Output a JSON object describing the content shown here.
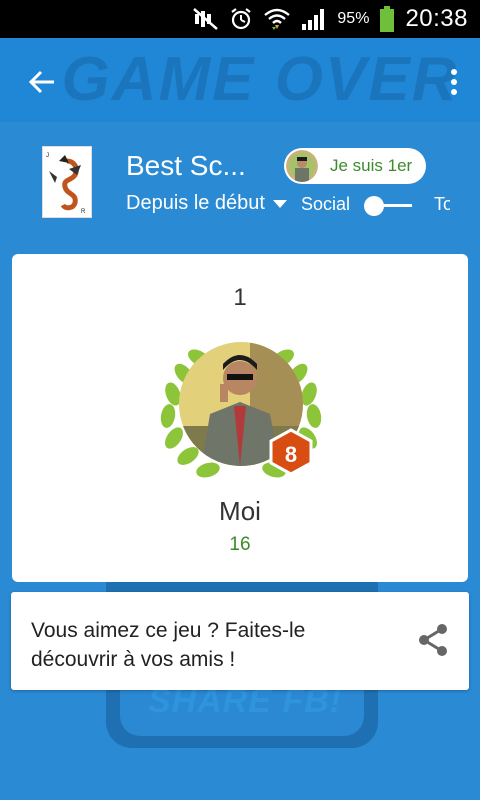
{
  "status_bar": {
    "battery_percent": "95%",
    "time": "20:38",
    "icons": [
      "mute-icon",
      "alarm-icon",
      "wifi-icon",
      "signal-icon",
      "battery-icon"
    ]
  },
  "app_bar": {
    "background_title": "GAME OVER",
    "back_icon": "arrow-back-icon",
    "menu_icon": "overflow-menu-icon"
  },
  "header": {
    "title": "Best Sc...",
    "period": "Depuis le début",
    "social_label": "Social",
    "tout_label": "To",
    "first_badge_label": "Je suis 1er"
  },
  "leaderboard_entry": {
    "rank": "1",
    "level": "8",
    "name": "Moi",
    "score": "16"
  },
  "share_background": {
    "text": "SHARE FB!"
  },
  "share_card": {
    "text": "Vous aimez ce jeu ? Faites-le découvrir à vos amis !",
    "icon": "share-icon"
  },
  "colors": {
    "primary": "#2087d6",
    "background": "#2a8ad4",
    "accent_green": "#3b8a2a",
    "level_badge": "#d84e12"
  }
}
